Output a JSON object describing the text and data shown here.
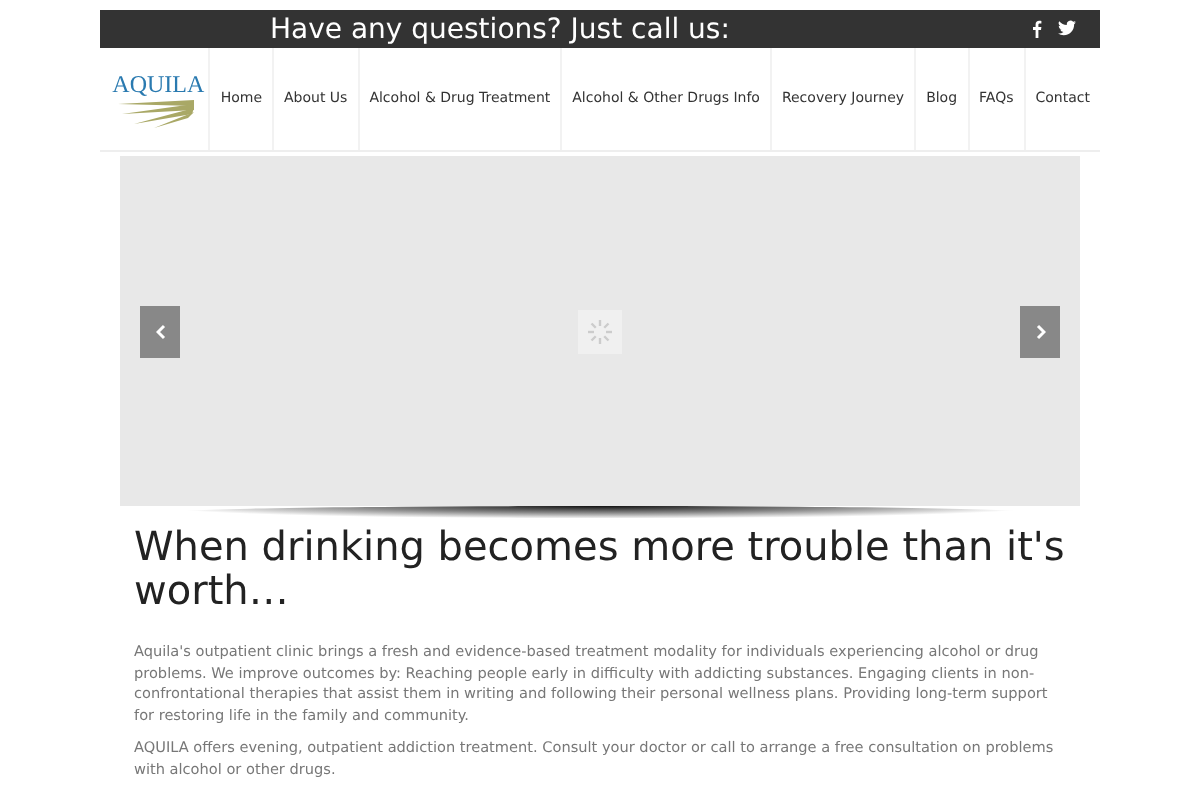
{
  "top_bar": {
    "message": "Have any questions? Just call us:"
  },
  "logo": {
    "text": "AQUILA"
  },
  "nav": [
    {
      "label": "Home"
    },
    {
      "label": "About Us"
    },
    {
      "label": "Alcohol & Drug Treatment"
    },
    {
      "label": "Alcohol & Other Drugs Info"
    },
    {
      "label": "Recovery Journey"
    },
    {
      "label": "Blog"
    },
    {
      "label": "FAQs"
    },
    {
      "label": "Contact"
    }
  ],
  "heading": "When drinking becomes more trouble than it's worth…",
  "paragraphs": [
    "Aquila's outpatient clinic brings a fresh and evidence-based treatment modality for individuals experiencing alcohol or drug problems. We improve outcomes by: Reaching people early in difficulty with addicting substances. Engaging clients in non-confrontational therapies that assist them in writing and following their personal wellness plans. Providing long-term support for restoring life in the family and community.",
    "AQUILA offers evening, outpatient addiction treatment. Consult your doctor or call to arrange a free consultation on problems with alcohol or other drugs."
  ]
}
